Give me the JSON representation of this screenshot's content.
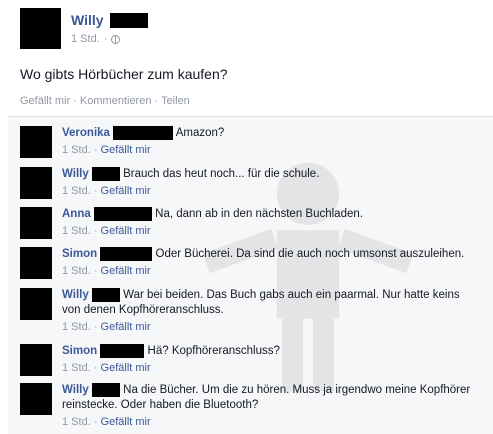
{
  "post": {
    "author": "Willy",
    "time": "1 Std.",
    "separator": "·",
    "text": "Wo gibts Hörbücher zum kaufen?",
    "actions": [
      "Gefällt mir",
      "Kommentieren",
      "Teilen"
    ]
  },
  "comments": [
    {
      "name": "Veronika",
      "text": "Amazon?",
      "time": "1 Std.",
      "like": "Gefällt mir"
    },
    {
      "name": "Willy",
      "text": "Brauch das heut noch... für die schule.",
      "time": "1 Std.",
      "like": "Gefällt mir"
    },
    {
      "name": "Anna",
      "text": "Na, dann ab in den nächsten Buchladen.",
      "time": "1 Std.",
      "like": "Gefällt mir"
    },
    {
      "name": "Simon",
      "text": "Oder Bücherei. Da sind die auch noch umsonst auszuleihen.",
      "time": "1 Std.",
      "like": "Gefällt mir"
    },
    {
      "name": "Willy",
      "text": "War bei beiden. Das Buch gabs auch ein paarmal. Nur hatte keins von denen Kopfhöreranschluss.",
      "time": "1 Std.",
      "like": "Gefällt mir"
    },
    {
      "name": "Simon",
      "text": "Hä? Kopfhöreranschluss?",
      "time": "1 Std.",
      "like": "Gefällt mir"
    },
    {
      "name": "Willy",
      "text": "Na die Bücher. Um die zu hören. Muss ja irgendwo meine Kopfhörer reinstecke. Oder haben die Bluetooth?",
      "time": "1 Std.",
      "like": "Gefällt mir"
    }
  ]
}
